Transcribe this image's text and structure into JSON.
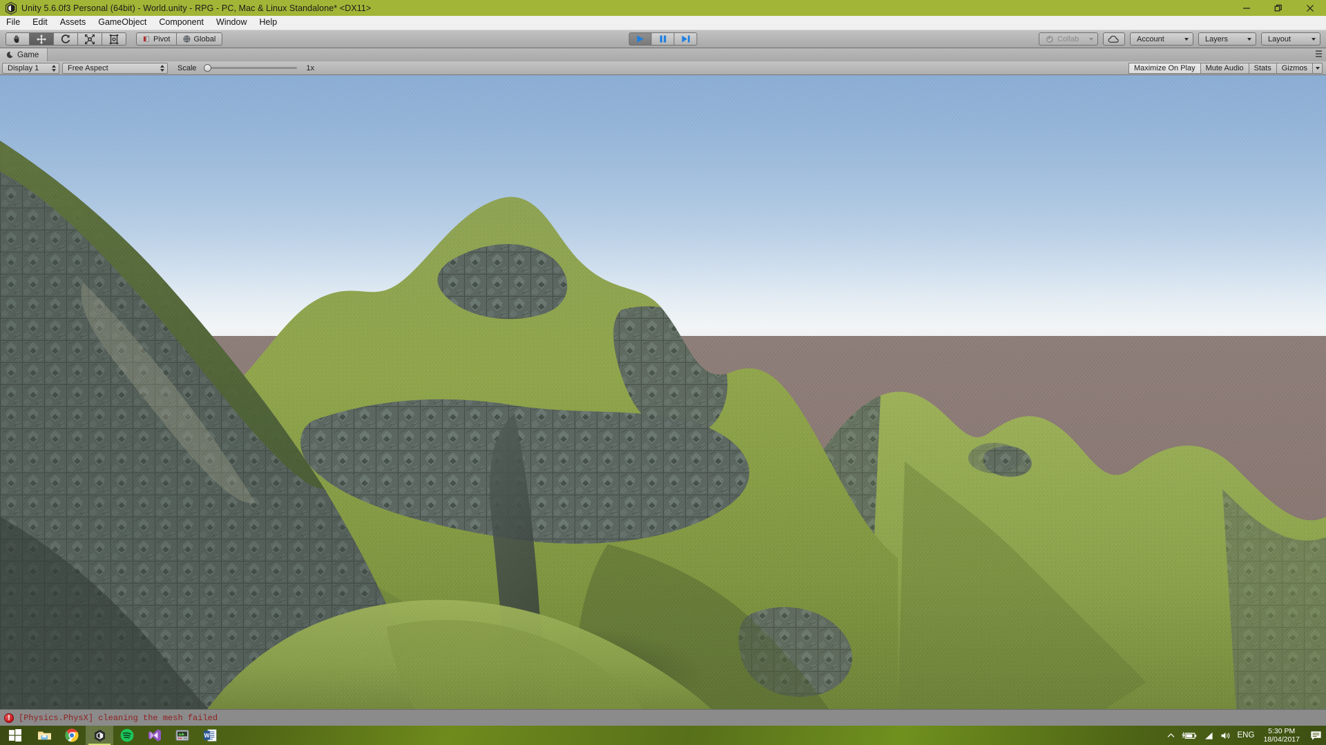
{
  "window": {
    "title": "Unity 5.6.0f3 Personal (64bit) - World.unity - RPG - PC, Mac & Linux Standalone* <DX11>",
    "logo_icon": "unity-logo-icon",
    "controls": [
      {
        "name": "minimize",
        "glyph": "—"
      },
      {
        "name": "restore",
        "glyph": "❐"
      },
      {
        "name": "close",
        "glyph": "✕"
      }
    ]
  },
  "menubar": {
    "items": [
      "File",
      "Edit",
      "Assets",
      "GameObject",
      "Component",
      "Window",
      "Help"
    ]
  },
  "toolbar": {
    "transform_tools": [
      {
        "name": "hand-tool",
        "icon": "hand-icon",
        "active": false
      },
      {
        "name": "move-tool",
        "icon": "move-arrows-icon",
        "active": true
      },
      {
        "name": "rotate-tool",
        "icon": "rotate-icon",
        "active": false
      },
      {
        "name": "scale-tool",
        "icon": "scale-icon",
        "active": false
      },
      {
        "name": "rect-tool",
        "icon": "rect-transform-icon",
        "active": false
      }
    ],
    "pivot_label": "Pivot",
    "pivot_icon": "pivot-icon",
    "global_label": "Global",
    "global_icon": "globe-icon",
    "play_controls": [
      {
        "name": "play-button",
        "icon": "play-icon",
        "active": true
      },
      {
        "name": "pause-button",
        "icon": "pause-icon",
        "active": false
      },
      {
        "name": "step-button",
        "icon": "step-icon",
        "active": false
      }
    ],
    "collab_label": "Collab",
    "collab_icon": "collab-check-icon",
    "cloud_icon": "cloud-icon",
    "account_label": "Account",
    "layers_label": "Layers",
    "layout_label": "Layout"
  },
  "panel": {
    "tab_label": "Game",
    "tab_icon": "game-view-icon",
    "menu_icon": "panel-menu-icon"
  },
  "gameview_bar": {
    "display_label": "Display 1",
    "aspect_label": "Free Aspect",
    "scale_label": "Scale",
    "scale_value": "1x",
    "scale_percent": 0,
    "maximize_on_play": "Maximize On Play",
    "mute_audio": "Mute Audio",
    "stats": "Stats",
    "gizmos": "Gizmos"
  },
  "scene": {
    "sky_top_color": "#8badd4",
    "sky_horizon_color": "#f2f5f6",
    "ground_color": "#8a7a76",
    "grass_color": "#8aa243",
    "rock_color": "#58635c",
    "description": "3D terrain with rolling green grass hills and tiled grey rock cliff faces under a clear blue sky"
  },
  "statusbar": {
    "icon": "error-icon",
    "message": "[Physics.PhysX] cleaning the mesh failed"
  },
  "taskbar": {
    "items": [
      {
        "name": "start-button",
        "icon": "windows-logo-icon",
        "active": false
      },
      {
        "name": "file-explorer",
        "icon": "folder-icon",
        "active": false
      },
      {
        "name": "chrome",
        "icon": "chrome-icon",
        "active": false
      },
      {
        "name": "unity",
        "icon": "unity-logo-icon",
        "active": true
      },
      {
        "name": "spotify",
        "icon": "spotify-icon",
        "active": false
      },
      {
        "name": "visual-studio",
        "icon": "visual-studio-icon",
        "active": false
      },
      {
        "name": "emulator",
        "icon": "emulator-icon",
        "active": false
      },
      {
        "name": "word",
        "icon": "word-icon",
        "active": false
      }
    ],
    "tray": {
      "overflow_icon": "chevron-up-icon",
      "battery_icon": "battery-charging-icon",
      "network_icon": "wifi-icon",
      "volume_icon": "volume-icon",
      "language": "ENG",
      "time": "5:30 PM",
      "date": "18/04/2017",
      "notifications_icon": "notifications-icon"
    }
  }
}
